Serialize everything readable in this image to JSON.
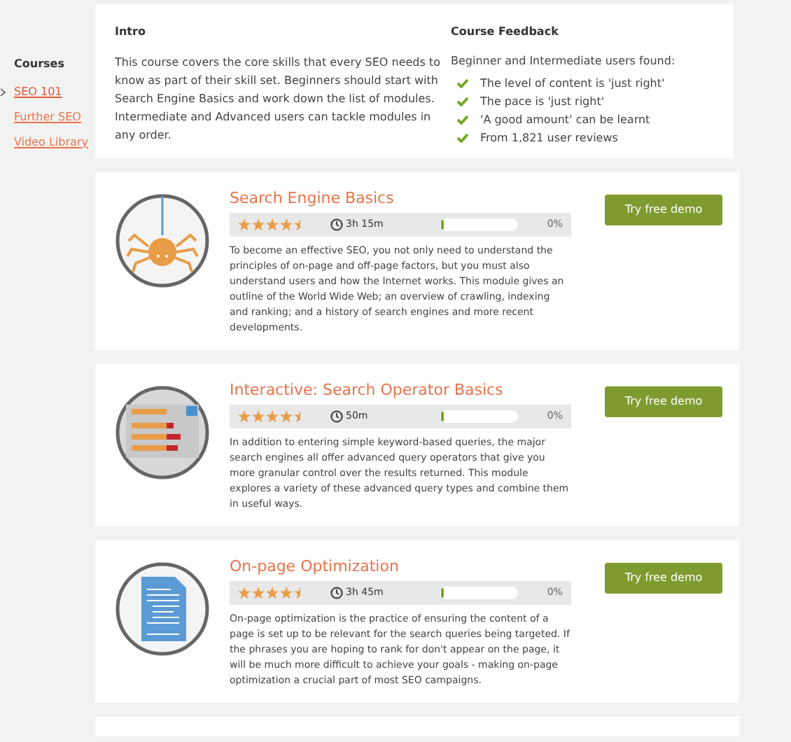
{
  "sidebar": {
    "heading": "Courses",
    "items": [
      {
        "label": "SEO 101",
        "selected": true
      },
      {
        "label": "Further SEO",
        "selected": false
      },
      {
        "label": "Video Library",
        "selected": false
      }
    ]
  },
  "intro": {
    "heading": "Intro",
    "text": "This course covers the core skills that every SEO needs to know as part of their skill set. Beginners should start with Search Engine Basics and work down the list of modules. Intermediate and Advanced users can tackle modules in any order."
  },
  "feedback": {
    "heading": "Course Feedback",
    "lead": "Beginner and Intermediate users found:",
    "items": [
      "The level of content is 'just right'",
      "The pace is 'just right'",
      "'A good amount' can be learnt",
      "From 1,821 user reviews"
    ]
  },
  "modules": [
    {
      "kind": "spider",
      "title": "Search Engine Basics",
      "stars": 4.5,
      "duration": "3h 15m",
      "level": 0.03,
      "percent": "0%",
      "description": "To become an effective SEO, you not only need to understand the principles of on-page and off-page factors, but you must also understand users and how the Internet works. This module gives an outline of the World Wide Web; an overview of crawling, indexing and ranking; and a history of search engines and more recent developments.",
      "button": "Try free demo"
    },
    {
      "kind": "results",
      "title": "Interactive: Search Operator Basics",
      "stars": 4.5,
      "duration": "50m",
      "level": 0.03,
      "percent": "0%",
      "description": "In addition to entering simple keyword-based queries, the major search engines all offer advanced query operators that give you more granular control over the results returned. This module explores a variety of these advanced query types and combine them in useful ways.",
      "button": "Try free demo"
    },
    {
      "kind": "document",
      "title": "On-page Optimization",
      "stars": 4.5,
      "duration": "3h 45m",
      "level": 0.03,
      "percent": "0%",
      "description": "On-page optimization is the practice of ensuring the content of a page is set up to be relevant for the search queries being targeted. If the phrases you are hoping to rank for don't appear on the page, it will be much more difficult to achieve your goals - making on-page optimization a crucial part of most SEO campaigns.",
      "button": "Try free demo"
    }
  ]
}
